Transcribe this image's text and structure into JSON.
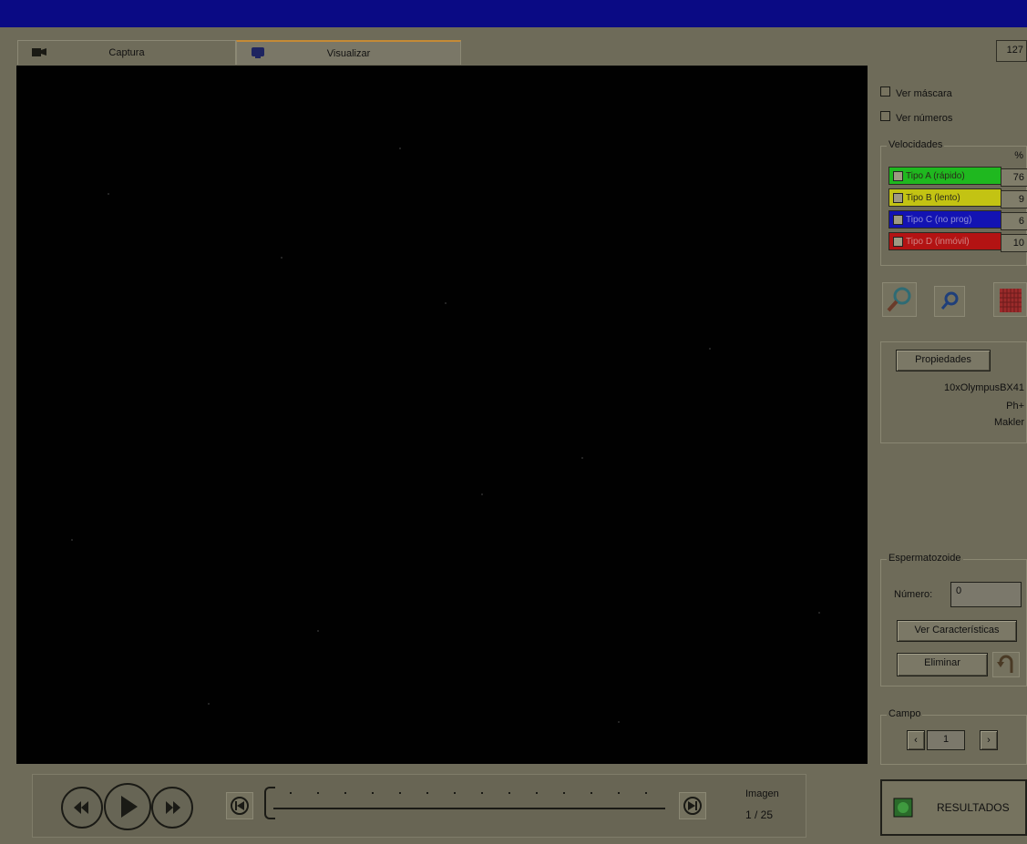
{
  "tabs": [
    {
      "label": "Captura",
      "active": false,
      "icon": "camera-icon"
    },
    {
      "label": "Visualizar",
      "active": true,
      "icon": "monitor-icon"
    }
  ],
  "counter_top": "127",
  "checkboxes": {
    "ver_mascara": "Ver máscara",
    "ver_numeros": "Ver números"
  },
  "velocidades": {
    "label": "Velocidades",
    "percent_header": "%",
    "rows": [
      {
        "label": "Tipo A (rápido)",
        "value": "76",
        "color": "#1fb81f",
        "checked": true
      },
      {
        "label": "Tipo B (lento)",
        "value": "9",
        "color": "#c3c313",
        "checked": true
      },
      {
        "label": "Tipo C (no prog)",
        "value": "6",
        "color": "#1313b3",
        "checked": true
      },
      {
        "label": "Tipo D (inmóvil)",
        "value": "10",
        "color": "#b31313",
        "checked": true
      }
    ]
  },
  "tools": [
    {
      "name": "zoom-in-icon"
    },
    {
      "name": "zoom-out-icon"
    },
    {
      "name": "grid-icon"
    }
  ],
  "properties": {
    "button": "Propiedades",
    "line1": "10xOlympusBX41",
    "line2": "Ph+",
    "line3": "Makler"
  },
  "espermatozoide": {
    "label": "Espermatozoide",
    "numero_label": "Número:",
    "numero_value": "0",
    "ver_caracteristicas": "Ver Características",
    "eliminar": "Eliminar"
  },
  "campo": {
    "label": "Campo",
    "value": "1"
  },
  "playback": {
    "imagen_label": "Imagen",
    "imagen_value": "1 / 25",
    "position_fraction": 0.0
  },
  "results_button": "RESULTADOS",
  "colors": {
    "title_bar": "#0a0a84",
    "viewer_bg": "#010101",
    "window_bg": "#6e6b59"
  }
}
